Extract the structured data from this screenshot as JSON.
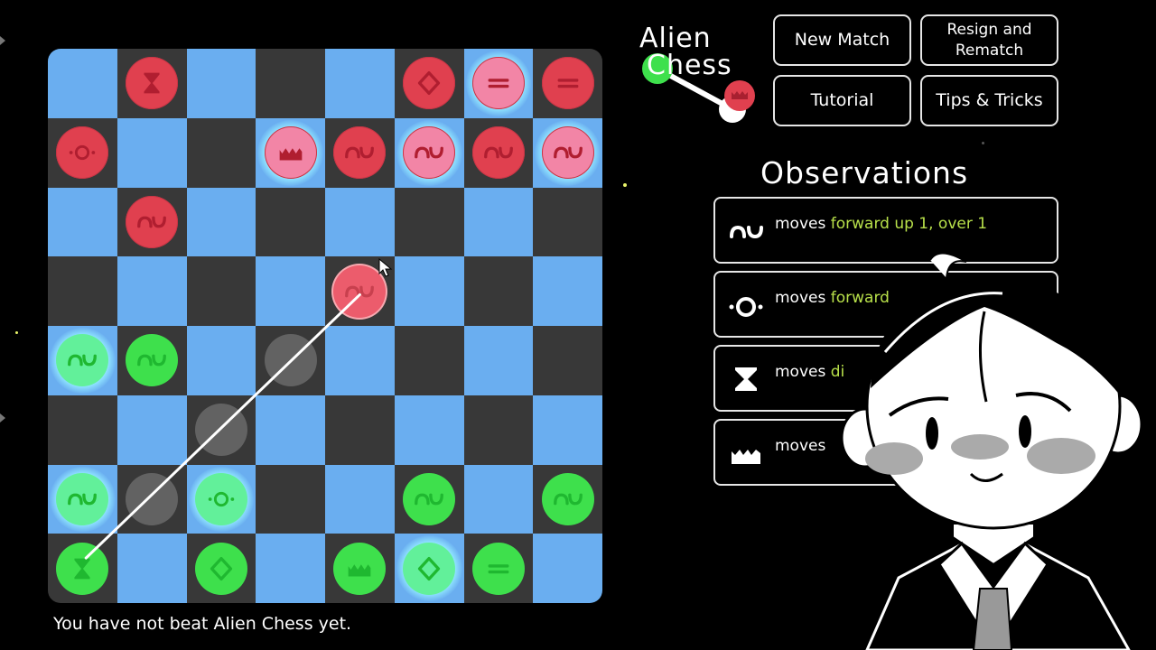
{
  "game": {
    "title_line1": "Alien",
    "title_line2": "Chess",
    "status_text": "You have not beat Alien Chess yet."
  },
  "menu": {
    "new_match": "New Match",
    "resign_rematch": "Resign and Rematch",
    "tutorial": "Tutorial",
    "tips_tricks": "Tips & Tricks"
  },
  "observations": {
    "title": "Observations",
    "items": [
      {
        "icon": "nu-glyph-icon",
        "prefix": "moves ",
        "highlight": "forward up 1, over 1"
      },
      {
        "icon": "ring-dots-glyph-icon",
        "prefix": "moves ",
        "highlight": "forward"
      },
      {
        "icon": "hourglass-glyph-icon",
        "prefix": "moves ",
        "highlight": "di"
      },
      {
        "icon": "crown-glyph-icon",
        "prefix": "moves ",
        "highlight": ""
      }
    ]
  },
  "colors": {
    "light_square": "#6aaef0",
    "dark_square": "#383838",
    "red_piece": "#e0404f",
    "green_piece": "#3ee04c",
    "highlight_text": "#b8e04a"
  },
  "board": {
    "pieces": [
      {
        "row": 0,
        "col": 1,
        "side": "red",
        "glyph": "hourglass"
      },
      {
        "row": 0,
        "col": 5,
        "side": "red",
        "glyph": "diamond"
      },
      {
        "row": 0,
        "col": 6,
        "side": "red",
        "glyph": "equals",
        "tone": "light",
        "glow": true
      },
      {
        "row": 0,
        "col": 7,
        "side": "red",
        "glyph": "equals"
      },
      {
        "row": 1,
        "col": 0,
        "side": "red",
        "glyph": "ring"
      },
      {
        "row": 1,
        "col": 3,
        "side": "red",
        "glyph": "crown",
        "tone": "light",
        "glow": true
      },
      {
        "row": 1,
        "col": 4,
        "side": "red",
        "glyph": "nu"
      },
      {
        "row": 1,
        "col": 5,
        "side": "red",
        "glyph": "nu",
        "tone": "light",
        "glow": true
      },
      {
        "row": 1,
        "col": 6,
        "side": "red",
        "glyph": "nu"
      },
      {
        "row": 1,
        "col": 7,
        "side": "red",
        "glyph": "nu",
        "tone": "light",
        "glow": true
      },
      {
        "row": 2,
        "col": 1,
        "side": "red",
        "glyph": "nu"
      },
      {
        "row": 3,
        "col": 4,
        "side": "red",
        "glyph": "nu",
        "selected": true
      },
      {
        "row": 4,
        "col": 0,
        "side": "green",
        "glyph": "nu",
        "tone": "light",
        "glow": true
      },
      {
        "row": 4,
        "col": 1,
        "side": "green",
        "glyph": "nu"
      },
      {
        "row": 4,
        "col": 3,
        "side": "ghost"
      },
      {
        "row": 5,
        "col": 2,
        "side": "ghost"
      },
      {
        "row": 6,
        "col": 0,
        "side": "green",
        "glyph": "nu",
        "tone": "light",
        "glow": true
      },
      {
        "row": 6,
        "col": 1,
        "side": "ghost"
      },
      {
        "row": 6,
        "col": 2,
        "side": "green",
        "glyph": "ring",
        "tone": "light",
        "glow": true
      },
      {
        "row": 6,
        "col": 5,
        "side": "green",
        "glyph": "nu"
      },
      {
        "row": 6,
        "col": 7,
        "side": "green",
        "glyph": "nu"
      },
      {
        "row": 7,
        "col": 0,
        "side": "green",
        "glyph": "hourglass"
      },
      {
        "row": 7,
        "col": 2,
        "side": "green",
        "glyph": "diamond"
      },
      {
        "row": 7,
        "col": 4,
        "side": "green",
        "glyph": "crown"
      },
      {
        "row": 7,
        "col": 5,
        "side": "green",
        "glyph": "diamond",
        "tone": "light",
        "glow": true
      },
      {
        "row": 7,
        "col": 6,
        "side": "green",
        "glyph": "equals"
      }
    ],
    "last_move": {
      "from": {
        "row": 7,
        "col": 0
      },
      "to": {
        "row": 3,
        "col": 4
      }
    }
  }
}
